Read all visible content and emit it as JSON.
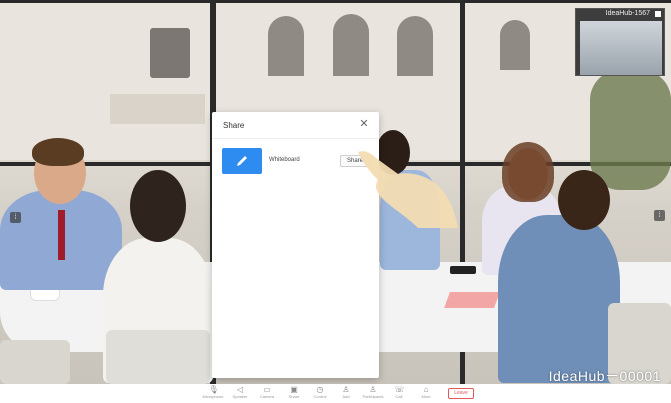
{
  "pip": {
    "title": "IdeaHub-1567"
  },
  "brand": {
    "text": "IdeaHub－00001"
  },
  "share_panel": {
    "title": "Share",
    "close_icon": "close-icon",
    "items": [
      {
        "label": "Whiteboard",
        "button": "Share",
        "icon": "pen-icon",
        "color": "#2e8bef"
      }
    ]
  },
  "toolbar": {
    "items": [
      {
        "label": "Microphone",
        "icon": "microphone-icon",
        "glyph": "🎙"
      },
      {
        "label": "Speaker",
        "icon": "speaker-icon",
        "glyph": "◁"
      },
      {
        "label": "Camera",
        "icon": "camera-icon",
        "glyph": "▭"
      },
      {
        "label": "Share",
        "icon": "share-icon",
        "glyph": "▣"
      },
      {
        "label": "Control",
        "icon": "control-icon",
        "glyph": "◷"
      },
      {
        "label": "Add",
        "icon": "add-participant-icon",
        "glyph": "♙"
      },
      {
        "label": "Participants",
        "icon": "participants-icon",
        "glyph": "♙"
      },
      {
        "label": "Call",
        "icon": "call-icon",
        "glyph": "☏"
      },
      {
        "label": "More",
        "icon": "more-icon",
        "glyph": "⌂"
      }
    ],
    "leave_label": "Leave"
  },
  "colors": {
    "accent": "#2e8bef",
    "leave": "#e05a5a"
  }
}
